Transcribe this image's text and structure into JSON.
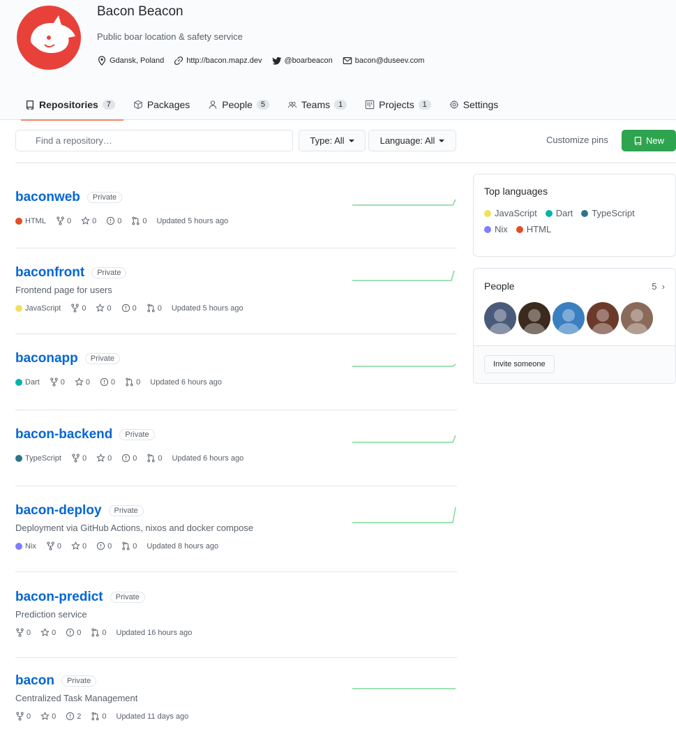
{
  "org": {
    "name": "Bacon Beacon",
    "description": "Public boar location & safety service",
    "location": "Gdansk, Poland",
    "website": "http://bacon.mapz.dev",
    "twitter": "@boarbeacon",
    "email": "bacon@duseev.com",
    "avatar_color": "#e8413a"
  },
  "tabs": [
    {
      "label": "Repositories",
      "count": "7",
      "icon": "repo-icon"
    },
    {
      "label": "Packages",
      "count": "",
      "icon": "package-icon"
    },
    {
      "label": "People",
      "count": "5",
      "icon": "person-icon"
    },
    {
      "label": "Teams",
      "count": "1",
      "icon": "people-icon"
    },
    {
      "label": "Projects",
      "count": "1",
      "icon": "project-icon"
    },
    {
      "label": "Settings",
      "count": "",
      "icon": "gear-icon"
    }
  ],
  "search": {
    "placeholder": "Find a repository…",
    "type_label": "Type: All",
    "language_label": "Language: All",
    "customize_label": "Customize pins",
    "new_label": "New"
  },
  "repos": [
    {
      "name": "baconweb",
      "badge": "Private",
      "description": "",
      "language": "HTML",
      "lang_color": "#e34c26",
      "forks": "0",
      "stars": "0",
      "issues": "0",
      "prs": "0",
      "updated": "Updated 5 hours ago"
    },
    {
      "name": "baconfront",
      "badge": "Private",
      "description": "Frontend page for users",
      "language": "JavaScript",
      "lang_color": "#f1e05a",
      "forks": "0",
      "stars": "0",
      "issues": "0",
      "prs": "0",
      "updated": "Updated 5 hours ago"
    },
    {
      "name": "baconapp",
      "badge": "Private",
      "description": "",
      "language": "Dart",
      "lang_color": "#00B4AB",
      "forks": "0",
      "stars": "0",
      "issues": "0",
      "prs": "0",
      "updated": "Updated 6 hours ago"
    },
    {
      "name": "bacon-backend",
      "badge": "Private",
      "description": "",
      "language": "TypeScript",
      "lang_color": "#2b7489",
      "forks": "0",
      "stars": "0",
      "issues": "0",
      "prs": "0",
      "updated": "Updated 6 hours ago"
    },
    {
      "name": "bacon-deploy",
      "badge": "Private",
      "description": "Deployment via GitHub Actions, nixos and docker compose",
      "language": "Nix",
      "lang_color": "#7e7eff",
      "forks": "0",
      "stars": "0",
      "issues": "0",
      "prs": "0",
      "updated": "Updated 8 hours ago"
    },
    {
      "name": "bacon-predict",
      "badge": "Private",
      "description": "Prediction service",
      "language": "",
      "lang_color": "",
      "forks": "0",
      "stars": "0",
      "issues": "0",
      "prs": "0",
      "updated": "Updated 16 hours ago"
    },
    {
      "name": "bacon",
      "badge": "Private",
      "description": "Centralized Task Management",
      "language": "",
      "lang_color": "",
      "forks": "0",
      "stars": "0",
      "issues": "2",
      "prs": "0",
      "updated": "Updated 11 days ago"
    }
  ],
  "top_languages": {
    "title": "Top languages",
    "items": [
      {
        "name": "JavaScript",
        "color": "#f1e05a"
      },
      {
        "name": "Dart",
        "color": "#00B4AB"
      },
      {
        "name": "TypeScript",
        "color": "#2b7489"
      },
      {
        "name": "Nix",
        "color": "#7e7eff"
      },
      {
        "name": "HTML",
        "color": "#e34c26"
      }
    ]
  },
  "people": {
    "title": "People",
    "count": "5",
    "invite_label": "Invite someone",
    "avatar_colors": [
      "#4a5a7a",
      "#3b2a1e",
      "#3a7fc0",
      "#6b3a2a",
      "#8a6a5a"
    ]
  },
  "colors": {
    "accent_link": "#0366d6",
    "new_button": "#2ea44f",
    "active_tab_underline": "#f9826c",
    "sparkline": "#7fd79a"
  }
}
